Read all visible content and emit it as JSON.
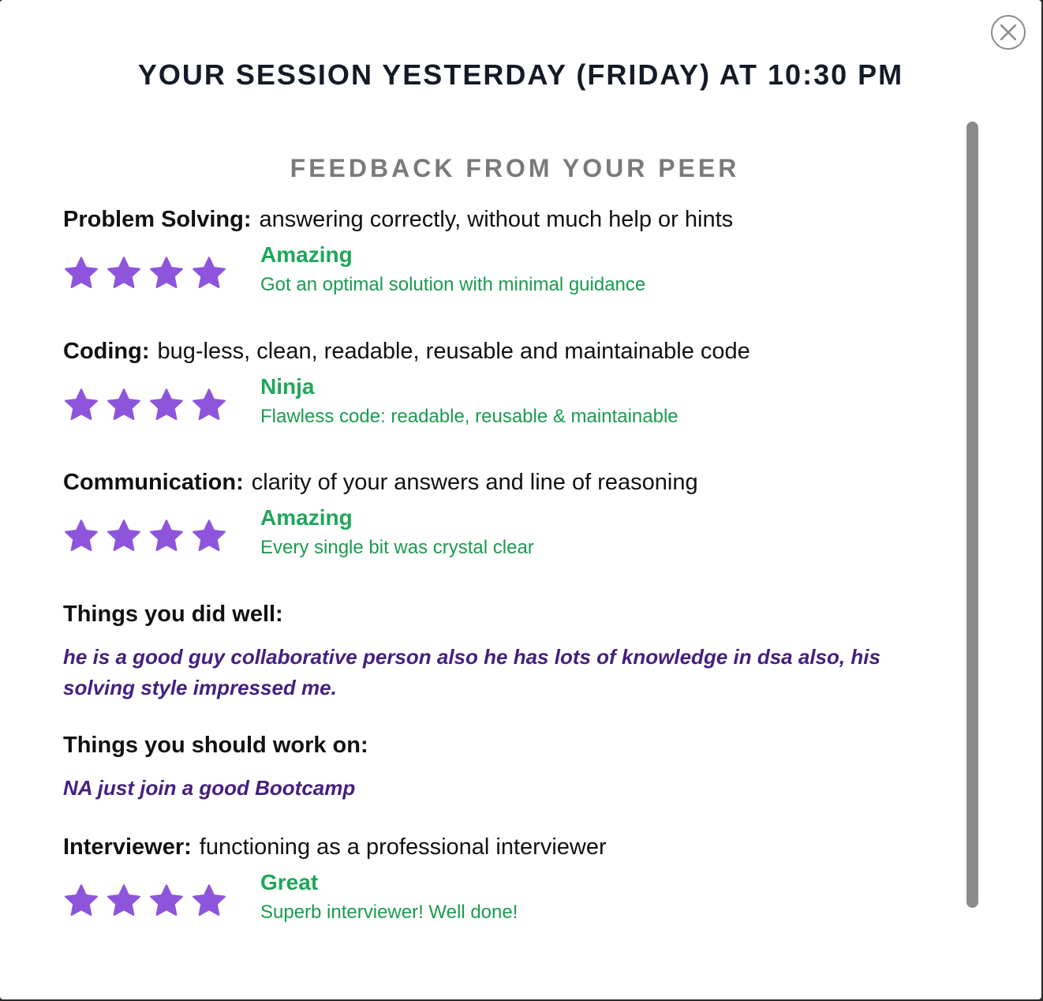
{
  "session_title": "YOUR SESSION YESTERDAY (FRIDAY) AT 10:30 PM",
  "feedback_heading": "FEEDBACK FROM YOUR PEER",
  "colors": {
    "star": "#8e55dc",
    "rating_green": "#1fa65a",
    "comment_purple": "#44207f"
  },
  "problem_solving": {
    "label": "Problem Solving:",
    "description": "answering correctly, without much help or hints",
    "stars": 4,
    "rating_title": "Amazing",
    "rating_desc": "Got an optimal solution with minimal guidance"
  },
  "coding": {
    "label": "Coding:",
    "description": "bug-less, clean, readable, reusable and maintainable code",
    "stars": 4,
    "rating_title": "Ninja",
    "rating_desc": "Flawless code: readable, reusable & maintainable"
  },
  "communication": {
    "label": "Communication:",
    "description": "clarity of your answers and line of reasoning",
    "stars": 4,
    "rating_title": "Amazing",
    "rating_desc": "Every single bit was crystal clear"
  },
  "did_well": {
    "label": "Things you did well:",
    "text": "he is a good guy collaborative person also he has lots of knowledge in dsa also, his solving style impressed me."
  },
  "work_on": {
    "label": "Things you should work on:",
    "text": "NA just join a good Bootcamp"
  },
  "interviewer": {
    "label": "Interviewer:",
    "description": "functioning as a professional interviewer",
    "stars": 4,
    "rating_title": "Great",
    "rating_desc": "Superb interviewer! Well done!"
  }
}
